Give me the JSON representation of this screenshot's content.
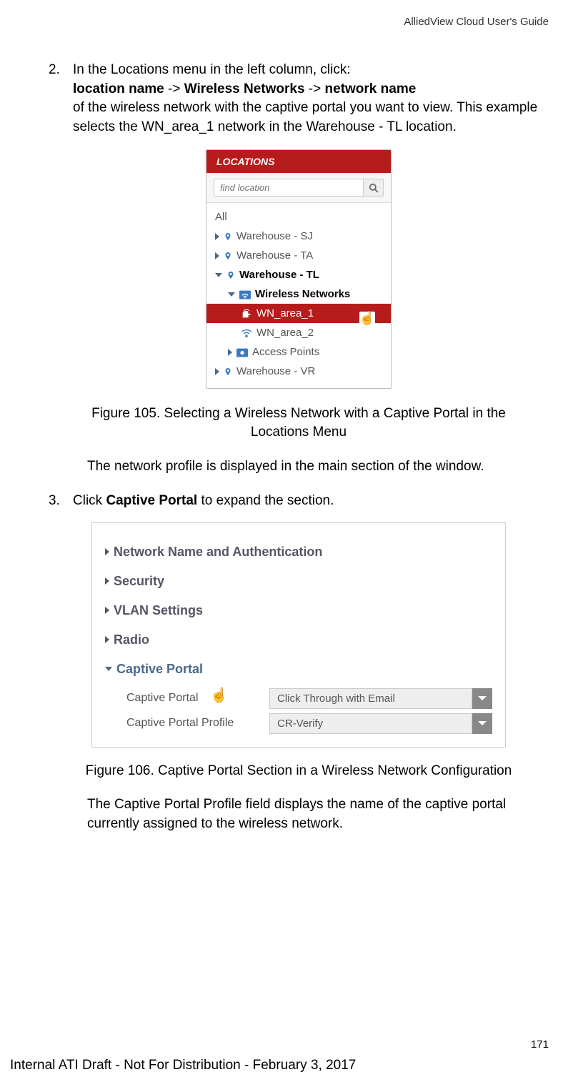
{
  "header": {
    "doc_title": "AlliedView Cloud User's Guide"
  },
  "steps": {
    "s2": {
      "num": "2.",
      "line1": "In the Locations menu in the left column, click:",
      "path_a": "location name",
      "sep1": " -> ",
      "path_b": "Wireless Networks",
      "sep2": " -> ",
      "path_c": "network name",
      "line3": "of the wireless network with the captive portal you want to view. This example selects the WN_area_1 network in the Warehouse - TL location."
    },
    "s3": {
      "num": "3.",
      "pre": "Click ",
      "bold": "Captive Portal",
      "post": " to expand the section."
    }
  },
  "fig105": {
    "header": "LOCATIONS",
    "search_placeholder": "find location",
    "all": "All",
    "item1": "Warehouse - SJ",
    "item2": "Warehouse - TA",
    "item3": "Warehouse - TL",
    "wn": "Wireless Networks",
    "wn1": "WN_area_1",
    "wn2": "WN_area_2",
    "ap": "Access Points",
    "item4": "Warehouse - VR",
    "caption": "Figure 105. Selecting a Wireless Network with a Captive Portal in the Locations Menu"
  },
  "para1": "The network profile is displayed in the main section of the window.",
  "fig106": {
    "sec1": "Network Name and Authentication",
    "sec2": "Security",
    "sec3": "VLAN Settings",
    "sec4": "Radio",
    "sec5": "Captive Portal",
    "field1_label": "Captive Portal",
    "field1_value": "Click Through with Email",
    "field2_label": "Captive Portal Profile",
    "field2_value": "CR-Verify",
    "caption": "Figure 106. Captive Portal Section in a Wireless Network Configuration"
  },
  "para2": "The Captive Portal Profile field displays the name of the captive portal currently assigned to the wireless network.",
  "page_num": "171",
  "footer": "Internal ATI Draft - Not For Distribution - February 3, 2017"
}
